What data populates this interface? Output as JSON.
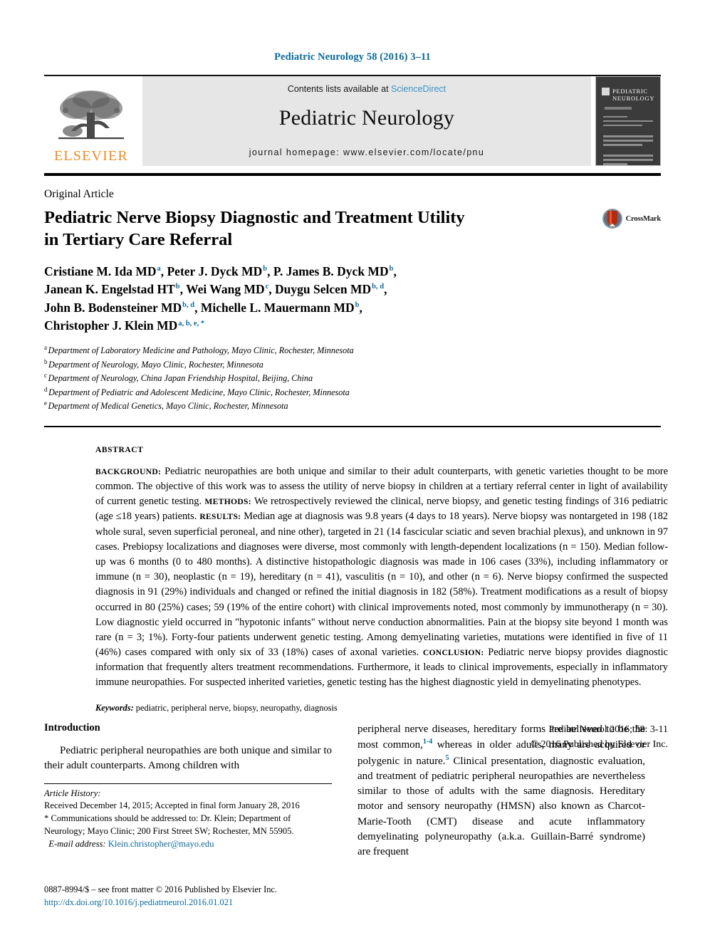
{
  "running_head": "Pediatric Neurology 58 (2016) 3–11",
  "masthead": {
    "publisher_name": "ELSEVIER",
    "contents_prefix": "Contents lists available at ",
    "contents_link": "ScienceDirect",
    "journal_title": "Pediatric Neurology",
    "homepage": "journal homepage: www.elsevier.com/locate/pnu",
    "cover_title_line1": "PEDIATRIC",
    "cover_title_line2": "NEUROLOGY"
  },
  "article": {
    "kicker": "Original Article",
    "title_line1": "Pediatric Nerve Biopsy Diagnostic and Treatment Utility",
    "title_line2": "in Tertiary Care Referral",
    "crossmark_label": "CrossMark"
  },
  "authors": [
    {
      "name": "Cristiane M. Ida MD",
      "sup": "a",
      "sep": ", "
    },
    {
      "name": "Peter J. Dyck MD",
      "sup": "b",
      "sep": ", "
    },
    {
      "name": "P. James B. Dyck MD",
      "sup": "b",
      "sep": ", "
    },
    {
      "name": "Janean K. Engelstad HT",
      "sup": "b",
      "sep": ", "
    },
    {
      "name": "Wei Wang MD",
      "sup": "c",
      "sep": ", "
    },
    {
      "name": "Duygu Selcen MD",
      "sup": "b, d",
      "sep": ", "
    },
    {
      "name": "John B. Bodensteiner MD",
      "sup": "b, d",
      "sep": ", "
    },
    {
      "name": "Michelle L. Mauermann MD",
      "sup": "b",
      "sep": ", "
    },
    {
      "name": "Christopher J. Klein MD",
      "sup": "a, b, e, *",
      "sep": ""
    }
  ],
  "affiliations": [
    {
      "mark": "a",
      "text": "Department of Laboratory Medicine and Pathology, Mayo Clinic, Rochester, Minnesota"
    },
    {
      "mark": "b",
      "text": "Department of Neurology, Mayo Clinic, Rochester, Minnesota"
    },
    {
      "mark": "c",
      "text": "Department of Neurology, China Japan Friendship Hospital, Beijing, China"
    },
    {
      "mark": "d",
      "text": "Department of Pediatric and Adolescent Medicine, Mayo Clinic, Rochester, Minnesota"
    },
    {
      "mark": "e",
      "text": "Department of Medical Genetics, Mayo Clinic, Rochester, Minnesota"
    }
  ],
  "abstract": {
    "label": "ABSTRACT",
    "background_label": "BACKGROUND:",
    "background_text": " Pediatric neuropathies are both unique and similar to their adult counterparts, with genetic varieties thought to be more common. The objective of this work was to assess the utility of nerve biopsy in children at a tertiary referral center in light of availability of current genetic testing. ",
    "methods_label": "METHODS:",
    "methods_text": " We retrospectively reviewed the clinical, nerve biopsy, and genetic testing findings of 316 pediatric (age ≤18 years) patients. ",
    "results_label": "RESULTS:",
    "results_text": " Median age at diagnosis was 9.8 years (4 days to 18 years). Nerve biopsy was nontargeted in 198 (182 whole sural, seven superficial peroneal, and nine other), targeted in 21 (14 fascicular sciatic and seven brachial plexus), and unknown in 97 cases. Prebiopsy localizations and diagnoses were diverse, most commonly with length-dependent localizations (n = 150). Median follow-up was 6 months (0 to 480 months). A distinctive histopathologic diagnosis was made in 106 cases (33%), including inflammatory or immune (n = 30), neoplastic (n = 19), hereditary (n = 41), vasculitis (n = 10), and other (n = 6). Nerve biopsy confirmed the suspected diagnosis in 91 (29%) individuals and changed or refined the initial diagnosis in 182 (58%). Treatment modifications as a result of biopsy occurred in 80 (25%) cases; 59 (19% of the entire cohort) with clinical improvements noted, most commonly by immunotherapy (n = 30). Low diagnostic yield occurred in \"hypotonic infants\" without nerve conduction abnormalities. Pain at the biopsy site beyond 1 month was rare (n = 3; 1%). Forty-four patients underwent genetic testing. Among demyelinating varieties, mutations were identified in five of 11 (46%) cases compared with only six of 33 (18%) cases of axonal varieties. ",
    "conclusion_label": "CONCLUSION:",
    "conclusion_text": " Pediatric nerve biopsy provides diagnostic information that frequently alters treatment recommendations. Furthermore, it leads to clinical improvements, especially in inflammatory immune neuropathies. For suspected inherited varieties, genetic testing has the highest diagnostic yield in demyelinating phenotypes.",
    "keywords_label": "Keywords:",
    "keywords_text": " pediatric, peripheral nerve, biopsy, neuropathy, diagnosis",
    "citation": "Pediatr Neurol 2016; 58: 3-11",
    "copyright": "© 2016 Published by Elsevier Inc."
  },
  "introduction": {
    "heading": "Introduction",
    "left_paragraph": "Pediatric peripheral neuropathies are both unique and similar to their adult counterparts. Among children with",
    "right_part1": "peripheral nerve diseases, hereditary forms are believed to be the most common,",
    "right_ref1": "1-4",
    "right_part2": " whereas in older adults, many are acquired or polygenic in nature.",
    "right_ref2": "5",
    "right_part3": " Clinical presentation, diagnostic evaluation, and treatment of pediatric peripheral neuropathies are nevertheless similar to those of adults with the same diagnosis. Hereditary motor and sensory neuropathy (HMSN) also known as Charcot-Marie-Tooth (CMT) disease and acute inflammatory demyelinating polyneuropathy (a.k.a. Guillain-Barré syndrome) are frequent"
  },
  "footnotes": {
    "history_label": "Article History:",
    "history_text": "Received December 14, 2015; Accepted in final form January 28, 2016",
    "correspondence": "* Communications should be addressed to: Dr. Klein; Department of Neurology; Mayo Clinic; 200 First Street SW; Rochester, MN 55905.",
    "email_label": "E-mail address:",
    "email": "Klein.christopher@mayo.edu"
  },
  "footer": {
    "issn_line": "0887-8994/$ – see front matter © 2016 Published by Elsevier Inc.",
    "doi": "http://dx.doi.org/10.1016/j.pediatrneurol.2016.01.021"
  },
  "colors": {
    "link_blue": "#0b6a9b",
    "sciencedirect_blue": "#3a93c9",
    "elsevier_orange": "#F08A1E",
    "band_gray": "#e6e6e6"
  }
}
